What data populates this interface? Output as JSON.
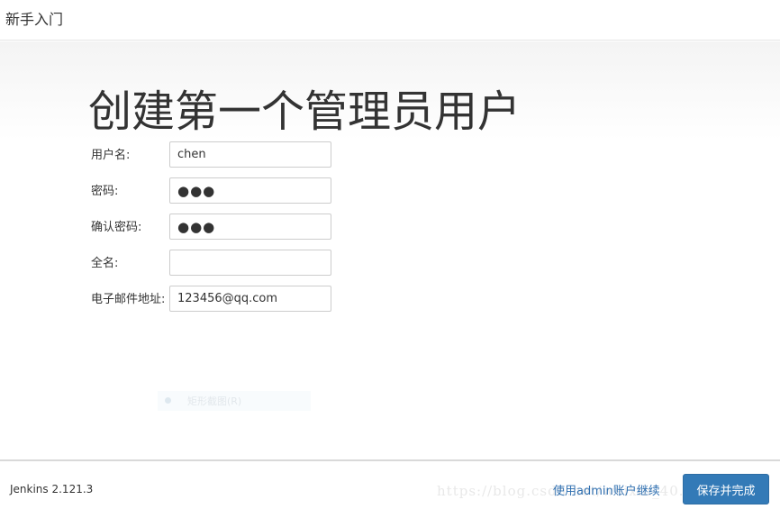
{
  "header": {
    "title": "新手入门"
  },
  "main": {
    "title": "创建第一个管理员用户",
    "fields": [
      {
        "label": "用户名:",
        "value": "chen"
      },
      {
        "label": "密码:",
        "value": "●●●"
      },
      {
        "label": "确认密码:",
        "value": "●●●"
      },
      {
        "label": "全名:",
        "value": ""
      },
      {
        "label": "电子邮件地址:",
        "value": "123456@qq.com"
      }
    ],
    "ghost_menu_item": "矩形截图(R)"
  },
  "footer": {
    "version": "Jenkins 2.121.3",
    "watermark": "https://blog.csdn.net/weixin_40...",
    "skip_link": "使用admin账户继续",
    "save_button": "保存并完成"
  },
  "colors": {
    "primary": "#337ab7",
    "link": "#2f6fb0"
  }
}
